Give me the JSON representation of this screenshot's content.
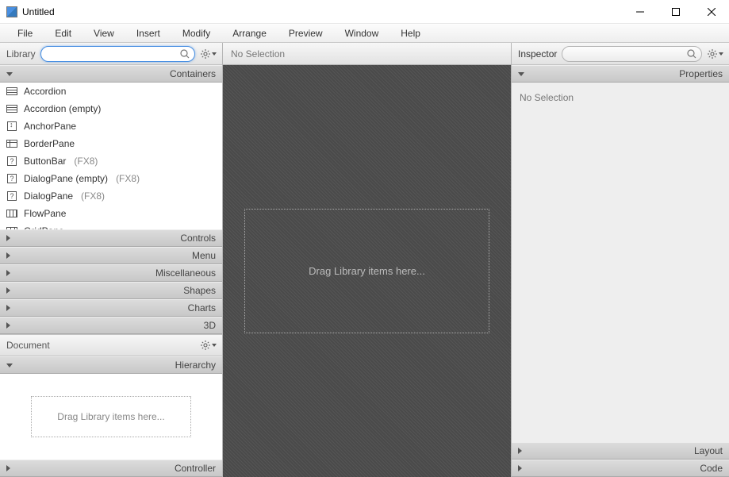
{
  "window": {
    "title": "Untitled"
  },
  "menu": {
    "items": [
      "File",
      "Edit",
      "View",
      "Insert",
      "Modify",
      "Arrange",
      "Preview",
      "Window",
      "Help"
    ]
  },
  "library": {
    "title": "Library",
    "sections": {
      "containers": "Containers",
      "controls": "Controls",
      "menu": "Menu",
      "misc": "Miscellaneous",
      "shapes": "Shapes",
      "charts": "Charts",
      "threeD": "3D"
    },
    "containers_items": [
      {
        "label": "Accordion",
        "icon": "accordion",
        "fx": ""
      },
      {
        "label": "Accordion  (empty)",
        "icon": "accordion",
        "fx": ""
      },
      {
        "label": "AnchorPane",
        "icon": "anchor",
        "fx": ""
      },
      {
        "label": "BorderPane",
        "icon": "border",
        "fx": ""
      },
      {
        "label": "ButtonBar",
        "icon": "q",
        "fx": "(FX8)"
      },
      {
        "label": "DialogPane (empty)",
        "icon": "q",
        "fx": "(FX8)"
      },
      {
        "label": "DialogPane",
        "icon": "q",
        "fx": "(FX8)"
      },
      {
        "label": "FlowPane",
        "icon": "flow",
        "fx": ""
      },
      {
        "label": "GridPane",
        "icon": "grid",
        "fx": ""
      }
    ]
  },
  "canvas": {
    "selection_label": "No Selection",
    "drop_hint": "Drag Library items here..."
  },
  "document": {
    "title": "Document",
    "hierarchy": "Hierarchy",
    "controller": "Controller",
    "drop_hint": "Drag Library items here..."
  },
  "inspector": {
    "title": "Inspector",
    "properties": "Properties",
    "layout": "Layout",
    "code": "Code",
    "no_selection": "No Selection"
  }
}
